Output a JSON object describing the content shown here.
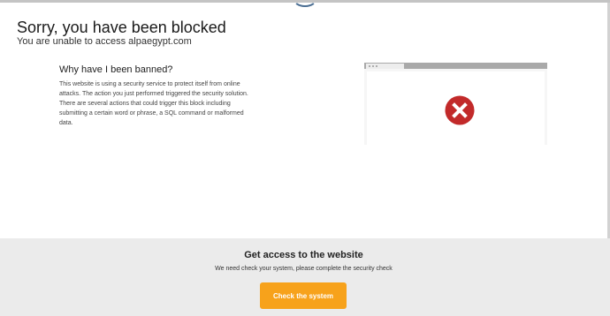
{
  "header": {
    "title": "Sorry, you have been blocked",
    "subtitle": "You are unable to access alpaegypt.com"
  },
  "explanation": {
    "title": "Why have I been banned?",
    "body": "This website is using a security service to protect itself from online attacks. The action you just performed triggered the security solution. There are several actions that could trigger this block including submitting a certain word or phrase, a SQL command or malformed data."
  },
  "illustration": {
    "icon": "error-x-icon",
    "icon_color": "#c22a2a"
  },
  "footer": {
    "title": "Get access to the website",
    "text": "We need check your system, please complete the security check",
    "button_label": "Check the system",
    "button_color": "#f7a21b"
  }
}
